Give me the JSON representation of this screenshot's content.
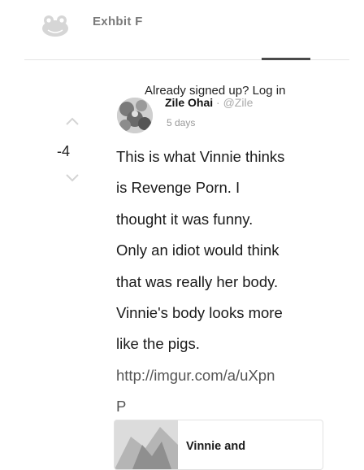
{
  "header": {
    "title": "Exhbit F",
    "logo_icon": "frog-logo-icon"
  },
  "signin": {
    "text": "Already signed up? Log in"
  },
  "comment": {
    "author": "Zile Ohai",
    "separator": "·",
    "handle": "@Zile",
    "timestamp": "5 days",
    "score": "-4",
    "lines": [
      "This is what Vinnie thinks",
      "is Revenge Porn. I",
      "thought it was funny.",
      "Only an idiot would think",
      "that was really her body.",
      "Vinnie's body looks more",
      "like the pigs.",
      "http://imgur.com/a/uXpn",
      "P"
    ]
  },
  "embed": {
    "title": "Vinnie and"
  },
  "icons": {
    "upvote": "chevron-up-icon",
    "downvote": "chevron-down-icon"
  }
}
